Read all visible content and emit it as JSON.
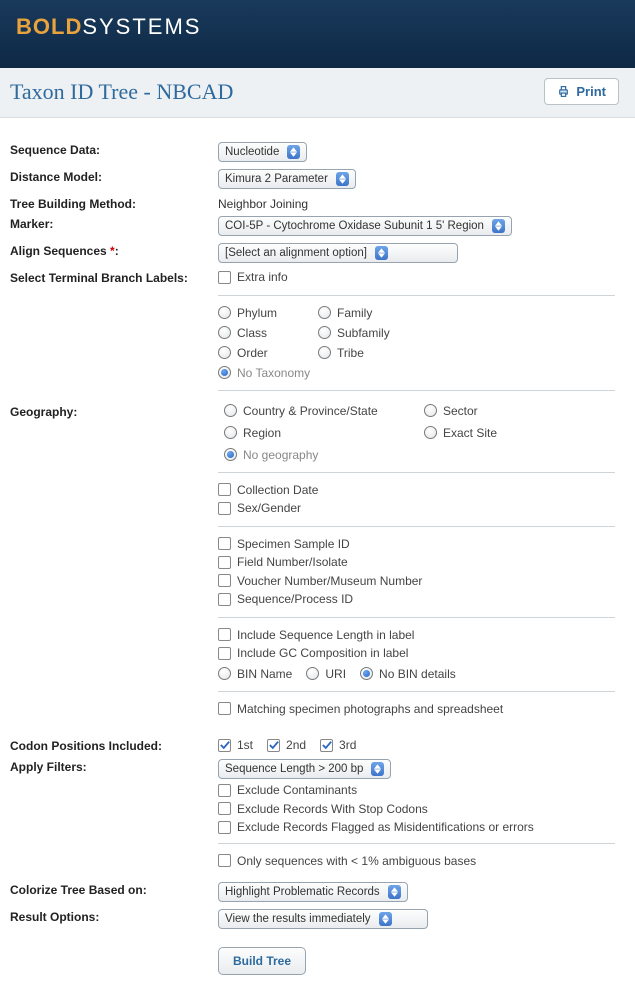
{
  "brand": {
    "bold": "BOLD",
    "systems": "SYSTEMS"
  },
  "title": "Taxon ID Tree - NBCAD",
  "print_label": "Print",
  "labels": {
    "sequence_data": "Sequence Data:",
    "distance_model": "Distance Model:",
    "tree_method": "Tree Building Method:",
    "marker": "Marker:",
    "align_sequences": "Align Sequences",
    "terminal_labels": "Select Terminal Branch Labels:",
    "geography": "Geography:",
    "codon_positions": "Codon Positions Included:",
    "apply_filters": "Apply Filters:",
    "colorize": "Colorize Tree Based on:",
    "result_options": "Result Options:"
  },
  "selects": {
    "sequence_data": "Nucleotide",
    "distance_model": "Kimura 2 Parameter",
    "marker": "COI-5P - Cytochrome Oxidase Subunit 1 5' Region",
    "align": "[Select an alignment option]",
    "filter": "Sequence Length > 200 bp",
    "colorize": "Highlight Problematic Records",
    "result": "View the results immediately"
  },
  "tree_method_value": "Neighbor Joining",
  "terminal": {
    "extra_info": "Extra info",
    "taxonomy": {
      "phylum": "Phylum",
      "family": "Family",
      "class": "Class",
      "subfamily": "Subfamily",
      "order": "Order",
      "tribe": "Tribe",
      "none": "No Taxonomy"
    }
  },
  "geography": {
    "country": "Country &  Province/State",
    "sector": "Sector",
    "region": "Region",
    "exact": "Exact Site",
    "none": "No geography"
  },
  "extras": {
    "collection_date": "Collection Date",
    "sex_gender": "Sex/Gender",
    "sample_id": "Specimen Sample ID",
    "field_number": "Field Number/Isolate",
    "voucher": "Voucher Number/Museum Number",
    "process_id": "Sequence/Process ID",
    "seq_length": "Include Sequence Length in label",
    "gc_comp": "Include GC Composition in label",
    "bin_name": "BIN Name",
    "uri": "URI",
    "no_bin": "No BIN details",
    "matching": "Matching specimen photographs and spreadsheet"
  },
  "codons": {
    "pos1": "1st",
    "pos2": "2nd",
    "pos3": "3rd"
  },
  "filters": {
    "contaminants": "Exclude Contaminants",
    "stop_codons": "Exclude Records With Stop Codons",
    "flagged": "Exclude Records Flagged as Misidentifications or errors",
    "ambiguous": "Only sequences with < 1% ambiguous bases"
  },
  "build_button": "Build Tree"
}
